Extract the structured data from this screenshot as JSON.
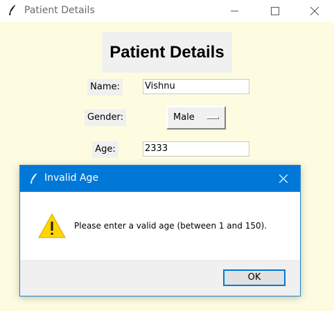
{
  "window": {
    "title": "Patient Details",
    "icon": "tk-feather-icon",
    "controls": [
      "minimize-icon",
      "maximize-icon",
      "close-icon"
    ]
  },
  "form": {
    "heading": "Patient Details",
    "name_label": "Name:",
    "name_value": "Vishnu",
    "gender_label": "Gender:",
    "gender_value": "Male",
    "age_label": "Age:",
    "age_value": "2333"
  },
  "dialog": {
    "title": "Invalid Age",
    "icon": "tk-feather-icon",
    "warning_icon": "warning-icon",
    "message": "Please enter a valid age (between 1 and 150).",
    "ok_label": "OK"
  },
  "colors": {
    "client_background": "#fefce0",
    "dialog_title_bar": "#0078d7",
    "warning_yellow": "#ffd400"
  }
}
